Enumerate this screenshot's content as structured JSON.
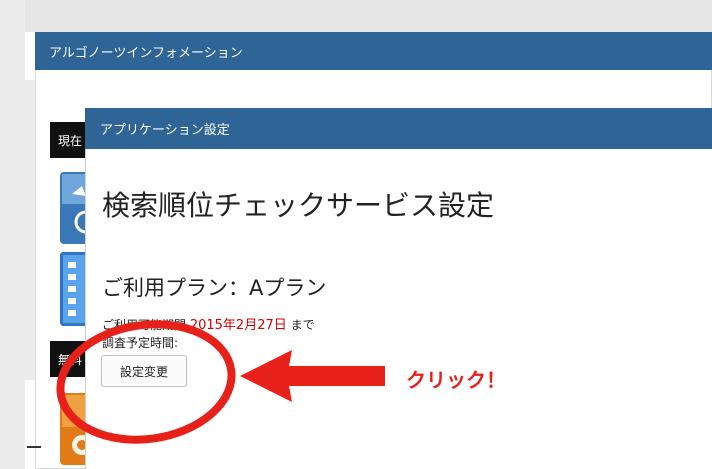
{
  "back_window": {
    "title": "アルゴノーツインフォメーション"
  },
  "back_labels": [
    "現在",
    "無料"
  ],
  "dialog": {
    "title": "アプリケーション設定",
    "page_title": "検索順位チェックサービス設定",
    "plan_heading": "ご利用プラン：Aプラン",
    "availability": {
      "prefix": "ご利用可能期間",
      "date": "2015年2月27日",
      "suffix": "まで"
    },
    "schedule_label": "調査予定時間:",
    "change_button": "設定変更"
  },
  "annotation": {
    "text": "クリック！",
    "color": "#e8201a"
  },
  "colors": {
    "header_blue": "#2e6496",
    "date_red": "#d40000"
  }
}
